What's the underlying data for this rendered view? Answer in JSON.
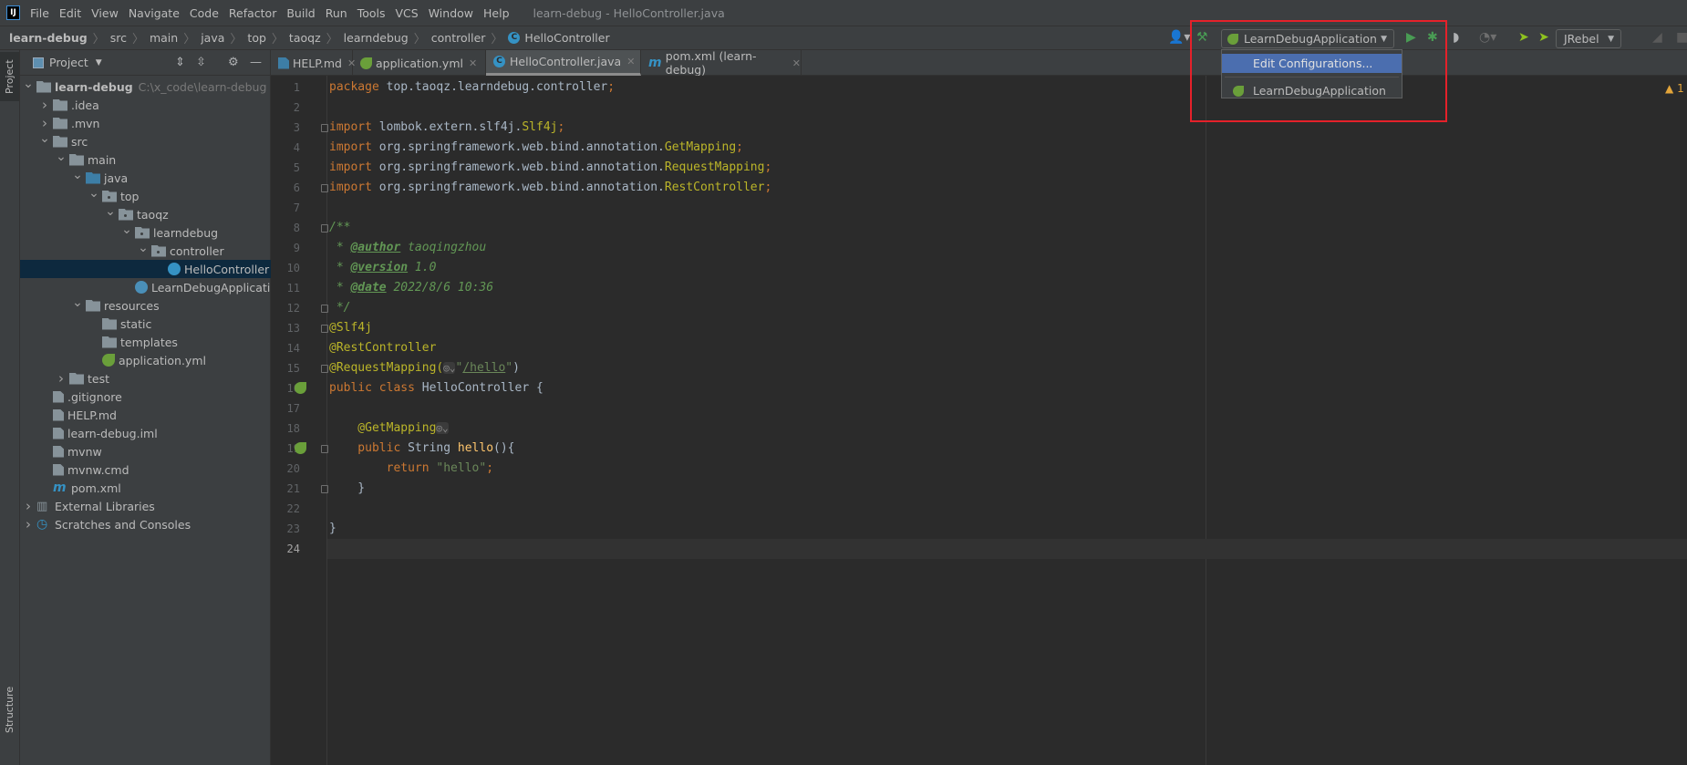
{
  "window": {
    "title": "learn-debug - HelloController.java",
    "logo": "IJ"
  },
  "menu": [
    "File",
    "Edit",
    "View",
    "Navigate",
    "Code",
    "Refactor",
    "Build",
    "Run",
    "Tools",
    "VCS",
    "Window",
    "Help"
  ],
  "breadcrumb": [
    "learn-debug",
    "src",
    "main",
    "java",
    "top",
    "taoqz",
    "learndebug",
    "controller",
    "HelloController"
  ],
  "toolbar": {
    "run_config": "LearnDebugApplication",
    "jrebel_combo": "JRebel",
    "icons": [
      "user-icon",
      "build-hammer-icon",
      "run-icon",
      "debug-icon",
      "coverage-icon",
      "profile-icon",
      "jrebel-run-icon",
      "jrebel-debug-icon",
      "attach-icon",
      "stop-icon"
    ],
    "popup": {
      "items": [
        "Edit Configurations...",
        "LearnDebugApplication"
      ],
      "highlighted": "Edit Configurations..."
    },
    "highlight_color": "#e5212a"
  },
  "sidebar": {
    "tabs": [
      "Project",
      "Structure"
    ]
  },
  "project_panel": {
    "title": "Project",
    "root_path": "C:\\x_code\\learn-debug",
    "tree": [
      {
        "label": "learn-debug",
        "level": 0,
        "arrow": "open",
        "icon": "module",
        "bold": true
      },
      {
        "label": ".idea",
        "level": 1,
        "arrow": "closed",
        "icon": "folder"
      },
      {
        "label": ".mvn",
        "level": 1,
        "arrow": "closed",
        "icon": "folder"
      },
      {
        "label": "src",
        "level": 1,
        "arrow": "open",
        "icon": "folder"
      },
      {
        "label": "main",
        "level": 2,
        "arrow": "open",
        "icon": "folder"
      },
      {
        "label": "java",
        "level": 3,
        "arrow": "open",
        "icon": "source-folder"
      },
      {
        "label": "top",
        "level": 4,
        "arrow": "open",
        "icon": "package"
      },
      {
        "label": "taoqz",
        "level": 5,
        "arrow": "open",
        "icon": "package"
      },
      {
        "label": "learndebug",
        "level": 6,
        "arrow": "open",
        "icon": "package"
      },
      {
        "label": "controller",
        "level": 7,
        "arrow": "open",
        "icon": "package"
      },
      {
        "label": "HelloController",
        "level": 8,
        "arrow": "none",
        "icon": "class",
        "selected": true
      },
      {
        "label": "LearnDebugApplication",
        "level": 7,
        "arrow": "none",
        "icon": "spring-class"
      },
      {
        "label": "resources",
        "level": 3,
        "arrow": "open",
        "icon": "folder"
      },
      {
        "label": "static",
        "level": 4,
        "arrow": "none",
        "icon": "folder"
      },
      {
        "label": "templates",
        "level": 4,
        "arrow": "none",
        "icon": "folder"
      },
      {
        "label": "application.yml",
        "level": 4,
        "arrow": "none",
        "icon": "spring"
      },
      {
        "label": "test",
        "level": 2,
        "arrow": "closed",
        "icon": "folder"
      },
      {
        "label": ".gitignore",
        "level": 1,
        "arrow": "none",
        "icon": "file"
      },
      {
        "label": "HELP.md",
        "level": 1,
        "arrow": "none",
        "icon": "file"
      },
      {
        "label": "learn-debug.iml",
        "level": 1,
        "arrow": "none",
        "icon": "file"
      },
      {
        "label": "mvnw",
        "level": 1,
        "arrow": "none",
        "icon": "file"
      },
      {
        "label": "mvnw.cmd",
        "level": 1,
        "arrow": "none",
        "icon": "file"
      },
      {
        "label": "pom.xml",
        "level": 1,
        "arrow": "none",
        "icon": "maven"
      },
      {
        "label": "External Libraries",
        "level": 0,
        "arrow": "closed",
        "icon": "libraries"
      },
      {
        "label": "Scratches and Consoles",
        "level": 0,
        "arrow": "closed",
        "icon": "scratches"
      }
    ]
  },
  "tabs": [
    {
      "label": "HELP.md",
      "icon": "markdown",
      "active": false
    },
    {
      "label": "application.yml",
      "icon": "spring",
      "active": false
    },
    {
      "label": "HelloController.java",
      "icon": "class",
      "active": true
    },
    {
      "label": "pom.xml (learn-debug)",
      "icon": "maven",
      "active": false
    }
  ],
  "editor": {
    "warning_count": "1",
    "current_line": 24,
    "lines": [
      [
        [
          "package ",
          "kw"
        ],
        [
          "top.taoqz.learndebug.controller",
          "df"
        ],
        [
          ";",
          "kw"
        ]
      ],
      [],
      [
        [
          "import ",
          "kw"
        ],
        [
          "lombok.extern.slf4j.",
          "df"
        ],
        [
          "Slf4j",
          "ty"
        ],
        [
          ";",
          "kw"
        ]
      ],
      [
        [
          "import ",
          "kw"
        ],
        [
          "org.springframework.web.bind.annotation.",
          "df"
        ],
        [
          "GetMapping",
          "ty"
        ],
        [
          ";",
          "kw"
        ]
      ],
      [
        [
          "import ",
          "kw"
        ],
        [
          "org.springframework.web.bind.annotation.",
          "df"
        ],
        [
          "RequestMapping",
          "ty"
        ],
        [
          ";",
          "kw"
        ]
      ],
      [
        [
          "import ",
          "kw"
        ],
        [
          "org.springframework.web.bind.annotation.",
          "df"
        ],
        [
          "RestController",
          "ty"
        ],
        [
          ";",
          "kw"
        ]
      ],
      [],
      [
        [
          "/**",
          "cm"
        ]
      ],
      [
        [
          " * ",
          "cm"
        ],
        [
          "@author",
          "tag"
        ],
        [
          " taoqingzhou",
          "cm"
        ]
      ],
      [
        [
          " * ",
          "cm"
        ],
        [
          "@version",
          "tag"
        ],
        [
          " 1.0",
          "cm"
        ]
      ],
      [
        [
          " * ",
          "cm"
        ],
        [
          "@date",
          "tag"
        ],
        [
          " 2022/8/6 10:36",
          "cm"
        ]
      ],
      [
        [
          " */",
          "cm"
        ]
      ],
      [
        [
          "@Slf4j",
          "an"
        ]
      ],
      [
        [
          "@RestController",
          "an"
        ]
      ],
      [
        [
          "@RequestMapping(",
          "an"
        ],
        [
          "◎⌄",
          "hint"
        ],
        [
          "\"",
          "str"
        ],
        [
          "/hello",
          "url"
        ],
        [
          "\"",
          "str"
        ],
        [
          ")",
          "df"
        ]
      ],
      [
        [
          "public class ",
          "kw"
        ],
        [
          "HelloController {",
          "df"
        ]
      ],
      [],
      [
        [
          "    @GetMapping",
          "an"
        ],
        [
          "◎⌄",
          "hint"
        ]
      ],
      [
        [
          "    public ",
          "kw"
        ],
        [
          "String ",
          "df"
        ],
        [
          "hello",
          "fn"
        ],
        [
          "(){",
          "df"
        ]
      ],
      [
        [
          "        return ",
          "kw"
        ],
        [
          "\"hello\"",
          "str"
        ],
        [
          ";",
          "kw"
        ]
      ],
      [
        [
          "    }",
          "df"
        ]
      ],
      [],
      [
        [
          "}",
          "df"
        ]
      ],
      []
    ]
  }
}
